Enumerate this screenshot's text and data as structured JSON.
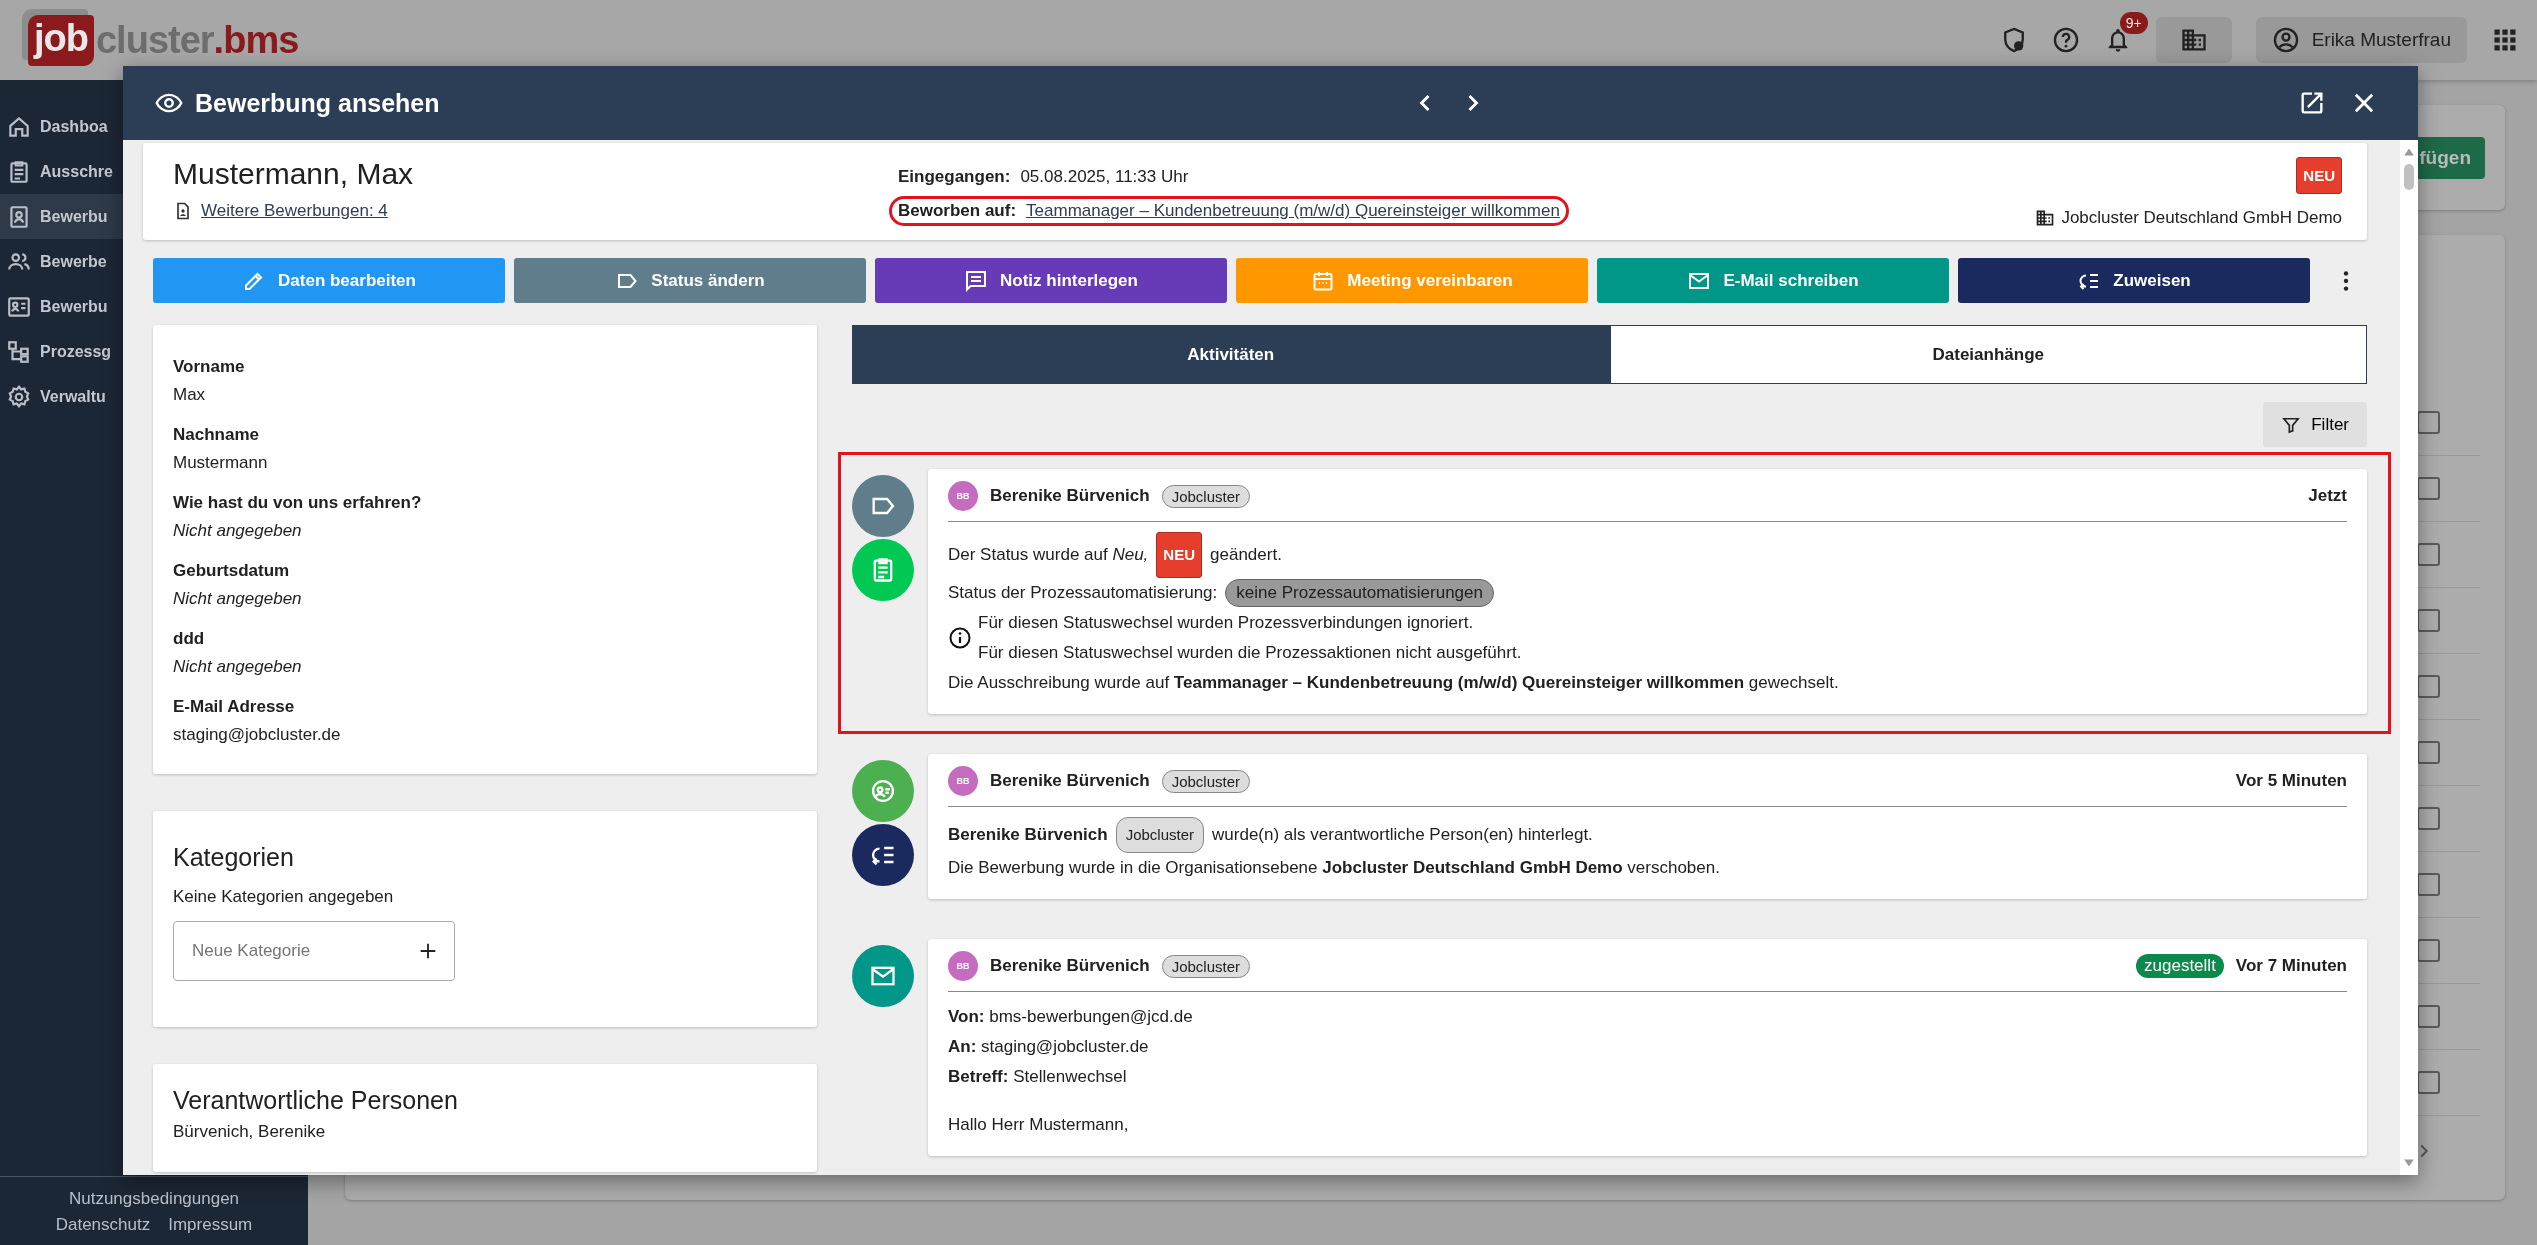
{
  "app_bar": {
    "logo": {
      "badge": "job",
      "middle": "cluster",
      "suffix": ".bms"
    },
    "notifications_badge": "9+",
    "user_name": "Erika Musterfrau"
  },
  "sidebar": {
    "items": [
      {
        "label": "Dashboa",
        "kind": "home",
        "selected": false
      },
      {
        "label": "Ausschre",
        "kind": "clipboard",
        "selected": false
      },
      {
        "label": "Bewerbu",
        "kind": "contact",
        "selected": true
      },
      {
        "label": "Bewerbe",
        "kind": "people",
        "selected": false
      },
      {
        "label": "Bewerbu",
        "kind": "card",
        "selected": false
      },
      {
        "label": "Prozessg",
        "kind": "hierarchy",
        "selected": false
      },
      {
        "label": "Verwaltu",
        "kind": "gear",
        "selected": false
      }
    ],
    "footer_links": [
      "Nutzungsbedingungen",
      "Datenschutz",
      "Impressum"
    ]
  },
  "background": {
    "action_button": "fügen",
    "rows": [
      {
        "checked": false
      },
      {
        "checked": false
      },
      {
        "checked": false
      },
      {
        "checked": false
      },
      {
        "checked": false
      },
      {
        "checked": false
      },
      {
        "checked": false
      },
      {
        "checked": false
      },
      {
        "checked": false
      },
      {
        "checked": false
      },
      {
        "checked": false
      }
    ]
  },
  "modal": {
    "title": "Bewerbung ansehen",
    "applicant": {
      "name": "Mustermann, Max",
      "more_link": "Weitere Bewerbungen: 4",
      "received_label": "Eingegangen:",
      "received_value": "05.08.2025, 11:33 Uhr",
      "applied_label": "Beworben auf:",
      "applied_link": "Teammanager – Kundenbetreuung (m/w/d) Quereinsteiger willkommen",
      "applied_highlighted": true,
      "status_badge": "NEU",
      "organization": "Jobcluster Deutschland GmbH Demo"
    },
    "actions": [
      {
        "label": "Daten bearbeiten",
        "kind": "pencil",
        "color": "#2196f3"
      },
      {
        "label": "Status ändern",
        "kind": "tag",
        "color": "#607d8b"
      },
      {
        "label": "Notiz hinterlegen",
        "kind": "note",
        "color": "#673ab7"
      },
      {
        "label": "Meeting vereinbaren",
        "kind": "calendar",
        "color": "#ff9800"
      },
      {
        "label": "E-Mail schreiben",
        "kind": "mail",
        "color": "#009688"
      },
      {
        "label": "Zuweisen",
        "kind": "assign",
        "color": "#1b2a5e"
      }
    ],
    "profile_fields": [
      {
        "label": "Vorname",
        "value": "Max",
        "missing": false
      },
      {
        "label": "Nachname",
        "value": "Mustermann",
        "missing": false
      },
      {
        "label": "Wie hast du von uns erfahren?",
        "value": "Nicht angegeben",
        "missing": true
      },
      {
        "label": "Geburtsdatum",
        "value": "Nicht angegeben",
        "missing": true
      },
      {
        "label": "ddd",
        "value": "Nicht angegeben",
        "missing": true
      },
      {
        "label": "E-Mail Adresse",
        "value": "staging@jobcluster.de",
        "missing": false
      }
    ],
    "categories": {
      "title": "Kategorien",
      "empty_text": "Keine Kategorien angegeben",
      "placeholder": "Neue Kategorie"
    },
    "responsible": {
      "title": "Verantwortliche Personen",
      "people": [
        "Bürvenich, Berenike"
      ]
    },
    "tabs": [
      {
        "label": "Aktivitäten",
        "selected": true
      },
      {
        "label": "Dateianhänge",
        "selected": false
      }
    ],
    "filter_button": "Filter",
    "activities": [
      {
        "highlighted": true,
        "icons": [
          {
            "kind": "tag",
            "color": "#607d8b"
          },
          {
            "kind": "clipboard",
            "color": "#00c853"
          }
        ],
        "avatar": "BB",
        "author": "Berenike Bürvenich",
        "chip": "Jobcluster",
        "time": "Jetzt",
        "body": [
          {
            "kind": "line",
            "parts": [
              {
                "kind": "text",
                "text": "Der Status wurde auf *Neu,*"
              },
              {
                "kind": "badge",
                "text": "NEU"
              },
              {
                "kind": "text",
                "text": "geändert."
              }
            ]
          },
          {
            "kind": "line",
            "parts": [
              {
                "kind": "text",
                "text": "Status der Prozessautomatisierung:"
              },
              {
                "kind": "pill",
                "text": "keine Prozessautomatisierungen"
              }
            ]
          },
          {
            "kind": "info",
            "lines": [
              "Für diesen Statuswechsel wurden Prozessverbindungen ignoriert.",
              "Für diesen Statuswechsel wurden die Prozessaktionen nicht ausgeführt."
            ]
          },
          {
            "kind": "line",
            "parts": [
              {
                "kind": "text",
                "text": "Die Ausschreibung wurde auf **Teammanager – Kundenbetreuung (m/w/d) Quereinsteiger willkommen** gewechselt."
              }
            ]
          }
        ]
      },
      {
        "highlighted": false,
        "icons": [
          {
            "kind": "person",
            "color": "#4caf50"
          },
          {
            "kind": "assign",
            "color": "#1b2a5e"
          }
        ],
        "avatar": "BB",
        "author": "Berenike Bürvenich",
        "chip": "Jobcluster",
        "time": "Vor 5 Minuten",
        "body": [
          {
            "kind": "line",
            "parts": [
              {
                "kind": "strong",
                "text": "Berenike Bürvenich"
              },
              {
                "kind": "chip",
                "text": "Jobcluster"
              },
              {
                "kind": "text",
                "text": "wurde(n) als verantwortliche Person(en) hinterlegt."
              }
            ]
          },
          {
            "kind": "line",
            "parts": [
              {
                "kind": "text",
                "text": "Die Bewerbung wurde in die Organisationsebene **Jobcluster Deutschland GmbH Demo** verschoben."
              }
            ]
          }
        ]
      },
      {
        "highlighted": false,
        "icons": [
          {
            "kind": "mail",
            "color": "#009688"
          }
        ],
        "avatar": "BB",
        "author": "Berenike Bürvenich",
        "chip": "Jobcluster",
        "delivery_status": "zugestellt",
        "time": "Vor 7 Minuten",
        "body": [
          {
            "kind": "line",
            "parts": [
              {
                "kind": "text",
                "text": "**Von:** bms-bewerbungen@jcd.de"
              }
            ]
          },
          {
            "kind": "line",
            "parts": [
              {
                "kind": "text",
                "text": "**An:**  staging@jobcluster.de"
              }
            ]
          },
          {
            "kind": "line",
            "parts": [
              {
                "kind": "text",
                "text": "**Betreff:** Stellenwechsel"
              }
            ]
          },
          {
            "kind": "paragraph",
            "parts": [
              {
                "kind": "text",
                "text": "Hallo Herr Mustermann,"
              }
            ]
          }
        ]
      }
    ]
  }
}
